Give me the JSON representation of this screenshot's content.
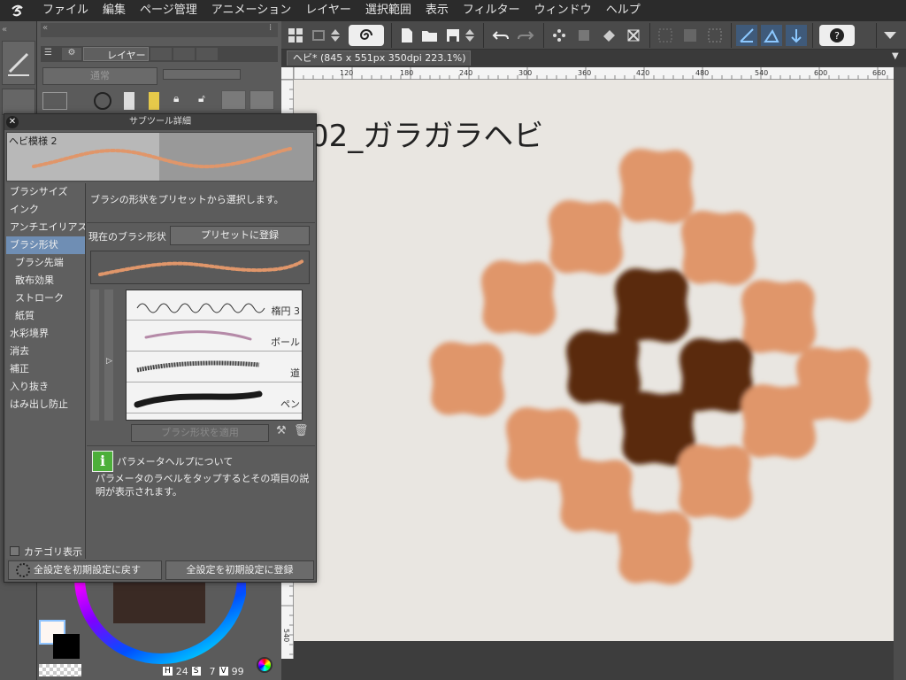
{
  "menubar": {
    "items": [
      "ファイル",
      "編集",
      "ページ管理",
      "アニメーション",
      "レイヤー",
      "選択範囲",
      "表示",
      "フィルター",
      "ウィンドウ",
      "ヘルプ"
    ]
  },
  "layer_panel": {
    "tab_label": "レイヤー",
    "blend_mode": "通常"
  },
  "document": {
    "tab_title": "ヘビ* (845 x 551px 350dpi 223.1%)",
    "canvas_heading": "02_ガラガラヘビ"
  },
  "ruler": {
    "top_ticks": [
      "120",
      "180",
      "240",
      "300",
      "360",
      "420",
      "480",
      "540",
      "600",
      "660"
    ],
    "left_tick": "540"
  },
  "dialog": {
    "title": "サブツール詳細",
    "brush_name": "ヘビ模様 2",
    "categories": [
      {
        "label": "ブラシサイズ"
      },
      {
        "label": "インク"
      },
      {
        "label": "アンチエイリアス"
      },
      {
        "label": "ブラシ形状",
        "selected": true
      },
      {
        "label": "ブラシ先端",
        "sub": true
      },
      {
        "label": "散布効果",
        "sub": true
      },
      {
        "label": "ストローク",
        "sub": true
      },
      {
        "label": "紙質",
        "sub": true
      },
      {
        "label": "水彩境界"
      },
      {
        "label": "消去"
      },
      {
        "label": "補正"
      },
      {
        "label": "入り抜き"
      },
      {
        "label": "はみ出し防止"
      }
    ],
    "description": "ブラシの形状をプリセットから選択します。",
    "current_shape_label": "現在のブラシ形状",
    "register_preset_button": "プリセットに登録",
    "brush_presets": [
      "楕円 3",
      "ボール",
      "道",
      "ペン"
    ],
    "apply_button": "ブラシ形状を適用",
    "help_title": "パラメータヘルプについて",
    "help_text": "パラメータのラベルをタップするとその項目の説明が表示されます。",
    "category_display": "カテゴリ表示",
    "reset_button": "全設定を初期設定に戻す",
    "register_default_button": "全設定を初期設定に登録"
  },
  "status": {
    "h_label": "H",
    "h_value": "24",
    "s_label": "S",
    "s_value": "7",
    "v_label": "V",
    "v_value": "99"
  },
  "colors": {
    "accent": "#6f8eb4",
    "snake_light": "#e0966a",
    "snake_dark": "#5a2a10"
  }
}
